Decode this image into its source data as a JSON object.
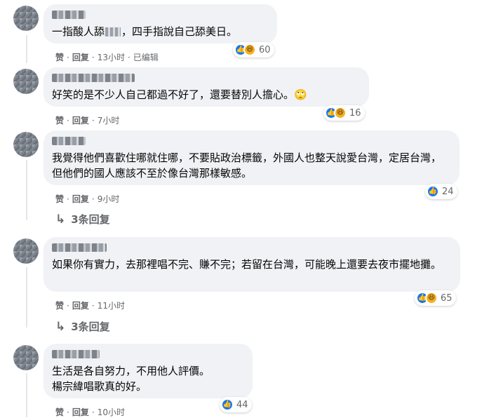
{
  "comments": [
    {
      "text_a": "一指酸人舔",
      "text_b": "，四手指說自己舔美日。",
      "reaction_count": "60",
      "reactions": [
        "like-icon",
        "haha-icon"
      ],
      "like": "赞",
      "reply": "回复",
      "time": "13小时",
      "edited": "已编辑"
    },
    {
      "text": "好笑的是不少人自己都過不好了，還要替別人擔心。🙄",
      "reaction_count": "16",
      "reactions": [
        "like-icon",
        "haha-icon"
      ],
      "like": "赞",
      "reply": "回复",
      "time": "7小时"
    },
    {
      "text": "我覺得他們喜歡住哪就住哪，不要貼政治標籤，外國人也整天說愛台灣，定居台灣，但他們的國人應該不至於像台灣那樣敏感。",
      "reaction_count": "24",
      "reactions": [
        "like-icon"
      ],
      "like": "赞",
      "reply": "回复",
      "time": "9小时",
      "replies_label": "3条回复"
    },
    {
      "text": "如果你有實力，去那裡唱不完、賺不完；若留在台灣，可能晚上還要去夜市擺地攤。",
      "reaction_count": "65",
      "reactions": [
        "like-icon",
        "haha-icon"
      ],
      "like": "赞",
      "reply": "回复",
      "time": "11小时",
      "replies_label": "3条回复"
    },
    {
      "text": "生活是各自努力，不用他人評價。\n楊宗緯唱歌真的好。",
      "reaction_count": "44",
      "reactions": [
        "like-icon"
      ],
      "like": "赞",
      "reply": "回复",
      "time": "10小时"
    }
  ],
  "colors": {
    "like": "#1877f2",
    "haha": "#f7b125",
    "bubble": "#f0f2f5",
    "meta": "#65676b"
  }
}
